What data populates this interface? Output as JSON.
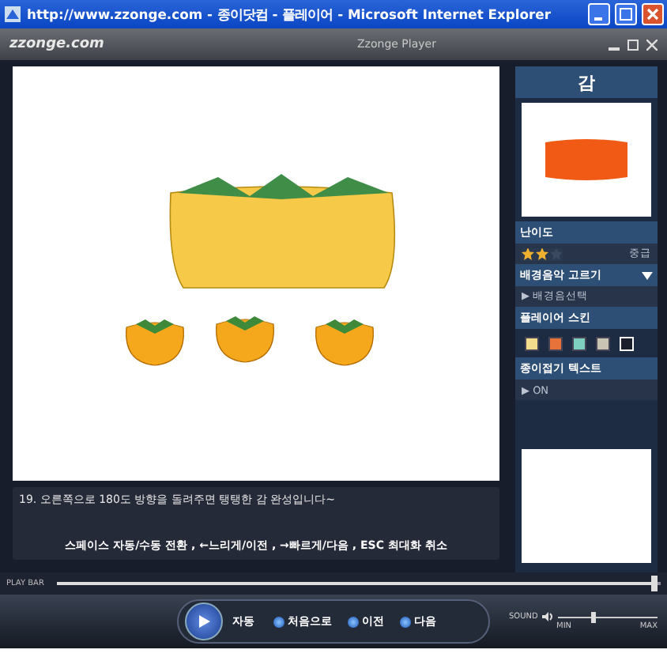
{
  "window": {
    "title": "http://www.zzonge.com - 종이닷컴 - 플레이어 - Microsoft Internet Explorer"
  },
  "player": {
    "logo": "zzonge.com",
    "title": "Zzonge Player"
  },
  "caption": {
    "step": "19. 오른쪽으로 180도 방향을 돌려주면 탱탱한 감 완성입니다~",
    "keys": "스페이스 자동/수동 전환 , ←느리게/이전 , →빠르게/다음 , ESC 최대화 취소"
  },
  "sidebar": {
    "title": "감",
    "difficulty_label": "난이도",
    "stars": 2,
    "difficulty": "중급",
    "music_header": "배경음악 고르기",
    "music_item": "▶ 배경음선택",
    "skin_header": "플레이어 스킨",
    "skins": [
      {
        "color": "#f3dc8c",
        "selected": false
      },
      {
        "color": "#e8733a",
        "selected": false
      },
      {
        "color": "#7fcfc0",
        "selected": false
      },
      {
        "color": "#c9c3b3",
        "selected": false
      },
      {
        "color": "#1a1f2b",
        "selected": true
      }
    ],
    "text_header": "종이접기 텍스트",
    "text_item": "▶ ON"
  },
  "playbar": {
    "label": "PLAY BAR",
    "level": 0.99
  },
  "controls": {
    "play": "자동",
    "buttons": [
      "처음으로",
      "이전",
      "다음"
    ]
  },
  "sound": {
    "label": "SOUND",
    "level": 0.35,
    "min": "MIN",
    "max": "MAX"
  }
}
